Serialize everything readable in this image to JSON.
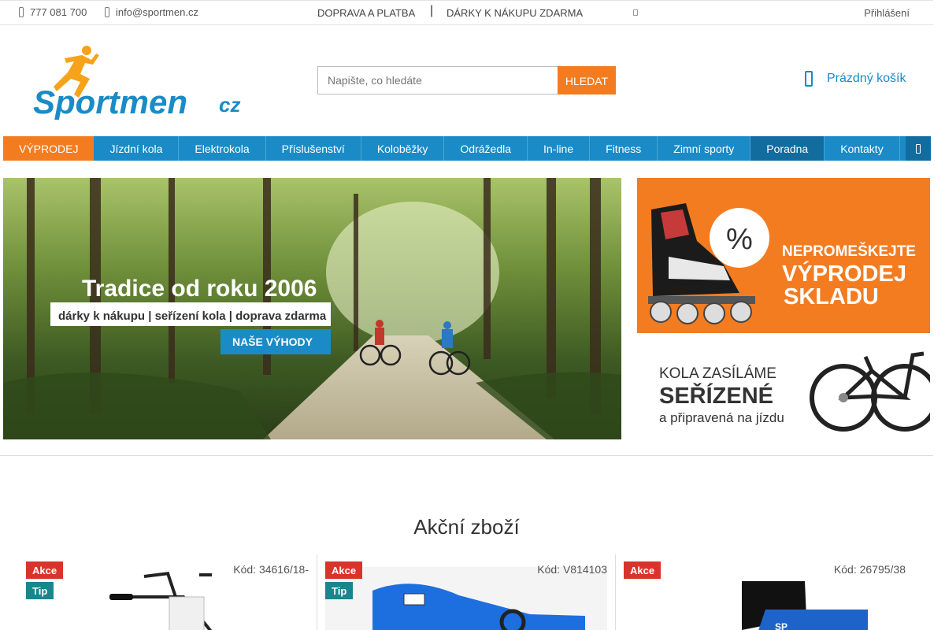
{
  "topbar": {
    "phone": "777 081 700",
    "email": "info@sportmen.cz",
    "shipping_link": "DOPRAVA A PLATBA",
    "separator": "|",
    "gifts_link": "DÁRKY K NÁKUPU ZDARMA",
    "login": "Přihlášení"
  },
  "header": {
    "logo_text": "Sportmen",
    "logo_suffix": "cz",
    "search": {
      "placeholder": "Napište, co hledáte",
      "button": "HLEDAT"
    },
    "cart_label": "Prázdný košík"
  },
  "nav": {
    "items": [
      {
        "label": "VÝPRODEJ"
      },
      {
        "label": "Jízdní kola"
      },
      {
        "label": "Elektrokola"
      },
      {
        "label": "Příslušenství"
      },
      {
        "label": "Koloběžky"
      },
      {
        "label": "Odrážedla"
      },
      {
        "label": "In-line"
      },
      {
        "label": "Fitness"
      },
      {
        "label": "Zimní sporty"
      },
      {
        "label": "Poradna"
      },
      {
        "label": "Kontakty"
      }
    ]
  },
  "hero": {
    "title": "Tradice od roku 2006",
    "subtitle": "dárky k nákupu | seřízení kola | doprava zdarma",
    "button": "NAŠE VÝHODY"
  },
  "banner_sale": {
    "percent": "%",
    "line1": "NEPROMEŠKEJTE",
    "line2": "VÝPRODEJ",
    "line3": "SKLADU"
  },
  "banner_bikes": {
    "line1": "KOLA ZASÍLÁME",
    "line2": "SEŘÍZENÉ",
    "line3": "a připravená na jízdu"
  },
  "section_title": "Akční zboží",
  "products": [
    {
      "badge_akce": "Akce",
      "badge_tip": "Tip",
      "code": "Kód: 34616/18-"
    },
    {
      "badge_akce": "Akce",
      "badge_tip": "Tip",
      "code": "Kód: V814103"
    },
    {
      "badge_akce": "Akce",
      "code": "Kód: 26795/38"
    }
  ],
  "colors": {
    "brand_blue": "#1a8bc6",
    "orange": "#f47c20",
    "akce_red": "#d9342b",
    "tip_teal": "#19868d"
  }
}
